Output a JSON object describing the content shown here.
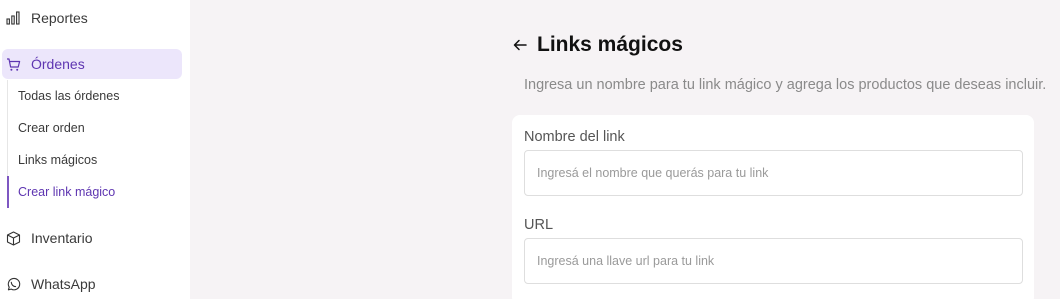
{
  "sidebar": {
    "items": [
      {
        "label": "Reportes",
        "icon": "bar-chart-icon"
      },
      {
        "label": "Órdenes",
        "icon": "cart-icon"
      },
      {
        "label": "Inventario",
        "icon": "box-icon"
      },
      {
        "label": "WhatsApp",
        "icon": "whatsapp-icon"
      }
    ],
    "orders_sub": [
      {
        "label": "Todas las órdenes"
      },
      {
        "label": "Crear orden"
      },
      {
        "label": "Links mágicos"
      },
      {
        "label": "Crear link mágico"
      }
    ],
    "active_item": "Órdenes",
    "active_sub": "Crear link mágico"
  },
  "header": {
    "back_icon": "arrow-left-icon",
    "title": "Links mágicos",
    "description": "Ingresa un nombre para tu link mágico y agrega los productos que deseas incluir."
  },
  "form": {
    "name_label": "Nombre del link",
    "name_value": "",
    "name_placeholder": "Ingresá el nombre que querás para tu link",
    "url_label": "URL",
    "url_value": "",
    "url_placeholder": "Ingresá una llave url para tu link"
  },
  "colors": {
    "accent": "#5e35b1",
    "active_bg": "#ece6fb",
    "page_bg": "#f6f3f5"
  }
}
